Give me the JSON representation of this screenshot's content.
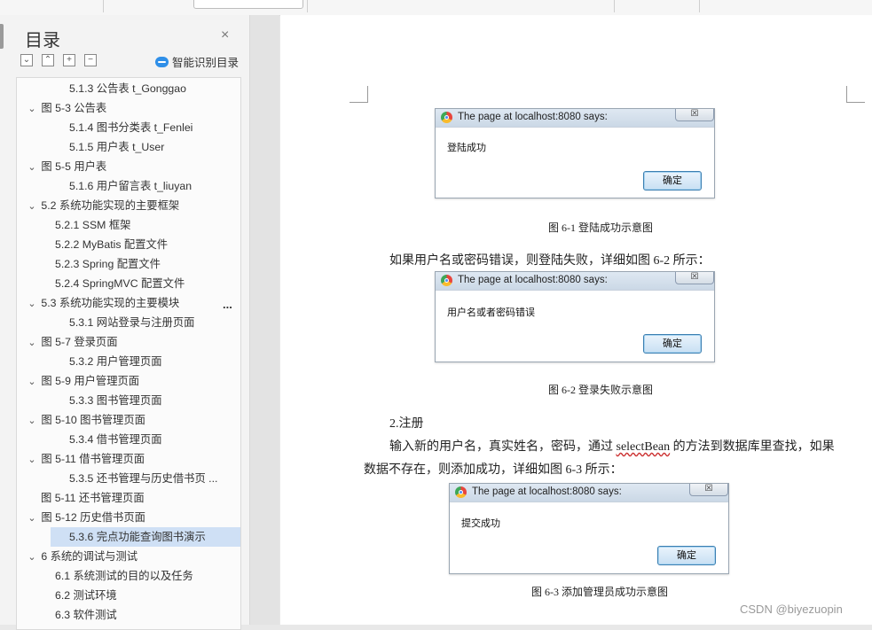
{
  "toc": {
    "title": "目录",
    "close_glyph": "×",
    "controls": [
      "⌄",
      "⌃",
      "+",
      "−"
    ],
    "smart_label": "智能识别目录",
    "more_glyph": "...",
    "items": [
      {
        "label": "5.1.3 公告表 t_Gonggao",
        "chevron": ""
      },
      {
        "label": "图  5-3  公告表",
        "chevron": "⌄"
      },
      {
        "label": "5.1.4 图书分类表 t_Fenlei",
        "chevron": ""
      },
      {
        "label": "5.1.5 用户表 t_User",
        "chevron": ""
      },
      {
        "label": "图  5-5  用户表",
        "chevron": "⌄"
      },
      {
        "label": "5.1.6 用户留言表 t_liuyan",
        "chevron": ""
      },
      {
        "label": "5.2 系统功能实现的主要框架",
        "chevron": "⌄"
      },
      {
        "label": "5.2.1 SSM 框架",
        "chevron": ""
      },
      {
        "label": "5.2.2 MyBatis 配置文件",
        "chevron": ""
      },
      {
        "label": "5.2.3 Spring 配置文件",
        "chevron": ""
      },
      {
        "label": "5.2.4 SpringMVC  配置文件",
        "chevron": ""
      },
      {
        "label": "5.3 系统功能实现的主要模块",
        "chevron": "⌄"
      },
      {
        "label": "5.3.1  网站登录与注册页面",
        "chevron": ""
      },
      {
        "label": "图  5-7  登录页面",
        "chevron": "⌄"
      },
      {
        "label": "5.3.2  用户管理页面",
        "chevron": ""
      },
      {
        "label": "图  5-9  用户管理页面",
        "chevron": "⌄"
      },
      {
        "label": "5.3.3  图书管理页面",
        "chevron": ""
      },
      {
        "label": "图  5-10  图书管理页面",
        "chevron": "⌄"
      },
      {
        "label": "5.3.4 借书管理页面",
        "chevron": ""
      },
      {
        "label": "图  5-11  借书管理页面",
        "chevron": "⌄"
      },
      {
        "label": "5.3.5  还书管理与历史借书页 ...",
        "chevron": ""
      },
      {
        "label": "图  5-11  还书管理页面",
        "chevron": ""
      },
      {
        "label": "图  5-12  历史借书页面",
        "chevron": "⌄"
      },
      {
        "label": "5.3.6 完点功能查询图书演示",
        "chevron": ""
      },
      {
        "label": "6 系统的调试与测试",
        "chevron": "⌄"
      },
      {
        "label": "6.1  系统测试的目的以及任务",
        "chevron": ""
      },
      {
        "label": "6.2  测试环境",
        "chevron": ""
      },
      {
        "label": "6.3  软件测试",
        "chevron": ""
      }
    ]
  },
  "document": {
    "dialogs": [
      {
        "title": "The page at localhost:8080 says:",
        "message": "登陆成功",
        "ok": "确定",
        "close": "☒"
      },
      {
        "title": "The page at localhost:8080 says:",
        "message": "用户名或者密码错误",
        "ok": "确定",
        "close": "☒"
      },
      {
        "title": "The page at localhost:8080 says:",
        "message": "提交成功",
        "ok": "确定",
        "close": "☒"
      }
    ],
    "captions": [
      "图 6-1  登陆成功示意图",
      "图 6-2  登录失败示意图",
      "图 6-3  添加管理员成功示意图"
    ],
    "para1": "如果用户名或密码错误，则登陆失败，详细如图 6-2 所示：",
    "heading2": "2.注册",
    "para2_pre": "输入新的用户名，真实姓名，密码，通过 ",
    "para2_code": "selectBean",
    "para2_post": " 的方法到数据库里查找，如果",
    "para3": "数据不存在，则添加成功，详细如图 6-3 所示："
  },
  "watermark": "CSDN @biyezuopin"
}
